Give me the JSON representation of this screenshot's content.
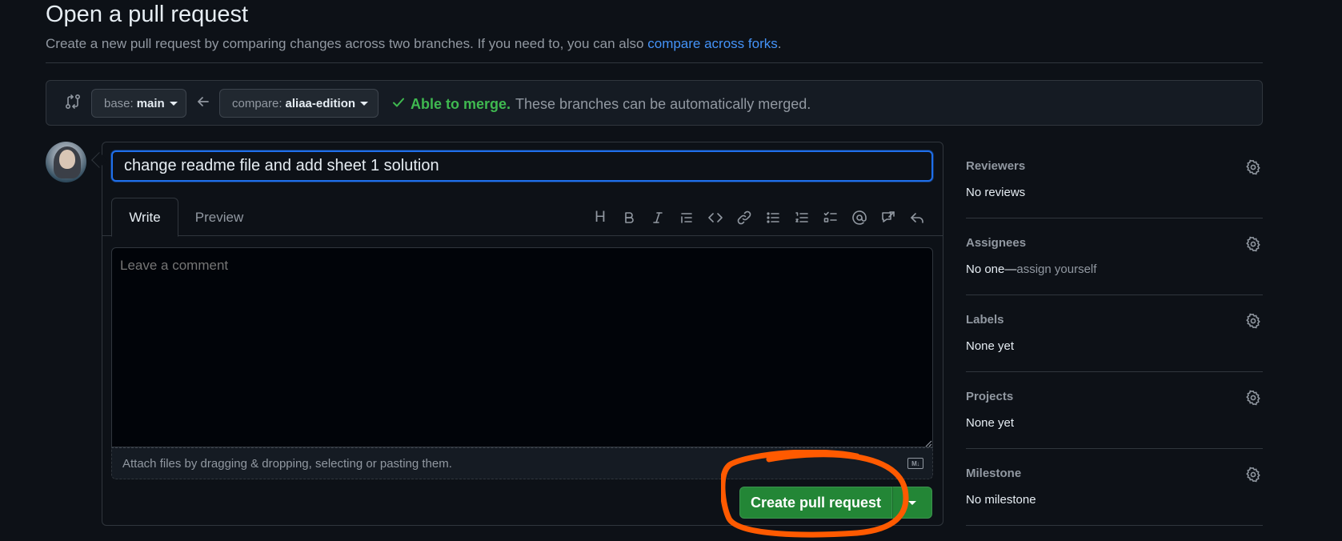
{
  "header": {
    "title": "Open a pull request",
    "subtitle": "Create a new pull request by comparing changes across two branches. If you need to, you can also",
    "subtitle_link": "compare across forks",
    "subtitle_end": "."
  },
  "compare": {
    "base_prefix": "base:",
    "base_branch": "main",
    "compare_prefix": "compare:",
    "compare_branch": "aliaa-edition",
    "merge_ok": "Able to merge.",
    "merge_msg": "These branches can be automatically merged."
  },
  "compose": {
    "title_value": "change readme file and add sheet 1 solution",
    "tab_write": "Write",
    "tab_preview": "Preview",
    "comment_placeholder": "Leave a comment",
    "attach_text": "Attach files by dragging & dropping, selecting or pasting them.",
    "md_badge": "M↓",
    "create_button": "Create pull request"
  },
  "toolbar": {
    "heading": "H"
  },
  "sidebar": {
    "sections": [
      {
        "heading": "Reviewers",
        "value": "No reviews"
      },
      {
        "heading": "Assignees",
        "value": "No one—",
        "value_extra": "assign yourself"
      },
      {
        "heading": "Labels",
        "value": "None yet"
      },
      {
        "heading": "Projects",
        "value": "None yet"
      },
      {
        "heading": "Milestone",
        "value": "No milestone"
      }
    ]
  },
  "colors": {
    "background": "#0d1117",
    "accent_blue": "#4493f8",
    "success_green": "#3fb950",
    "button_green": "#238636",
    "annotation_orange": "#ff5a00"
  }
}
